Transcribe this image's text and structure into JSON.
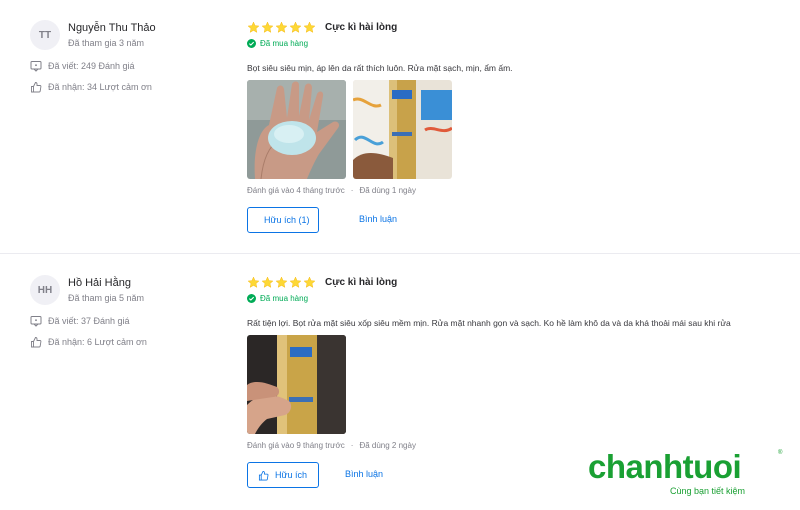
{
  "reviews": [
    {
      "avatar": "TT",
      "name": "Nguyễn Thu Thảo",
      "joined": "Đã tham gia 3 năm",
      "written": "Đã viết: 249 Đánh giá",
      "received": "Đã nhận: 34 Lượt cảm ơn",
      "stars": 5,
      "rating_title": "Cực kì hài lòng",
      "bought": "Đã mua hàng",
      "text": "Bọt siêu siêu mịn, áp lên da rất thích luôn. Rửa mặt sạch, mịn, ẩm ấm.",
      "photos": [
        "photo-foam-in-hand",
        "photo-product-bottle"
      ],
      "review_date": "Đánh giá vào 4 tháng trước",
      "used": "Đã dùng 1 ngày",
      "helpful": "Hữu ích (1)",
      "comment": "Bình luận"
    },
    {
      "avatar": "HH",
      "name": "Hồ Hải Hằng",
      "joined": "Đã tham gia 5 năm",
      "written": "Đã viết: 37 Đánh giá",
      "received": "Đã nhận: 6 Lượt cảm ơn",
      "stars": 5,
      "rating_title": "Cực kì hài lòng",
      "bought": "Đã mua hàng",
      "text": "Rất tiện lợi. Bọt rửa mặt siêu xốp siêu mềm mịn. Rửa mặt nhanh gọn và sạch. Ko hề làm khô da và da khá thoải mái sau khi rửa",
      "photos": [
        "photo-product-in-hand"
      ],
      "review_date": "Đánh giá vào 9 tháng trước",
      "used": "Đã dùng 2 ngày",
      "helpful": "Hữu ích",
      "comment": "Bình luận"
    }
  ],
  "logo": {
    "text": "chanhtuoi",
    "tagline": "Cùng bạn tiết kiệm",
    "mark": "®"
  },
  "colors": {
    "accent": "#0b74e5",
    "green": "#00ab56",
    "star": "#fdd836",
    "brand": "#1aa033"
  },
  "icons": {
    "written": "review-icon",
    "received": "thumbs-up-icon",
    "bought": "check-circle-icon",
    "helpful": "thumbs-up-icon"
  }
}
